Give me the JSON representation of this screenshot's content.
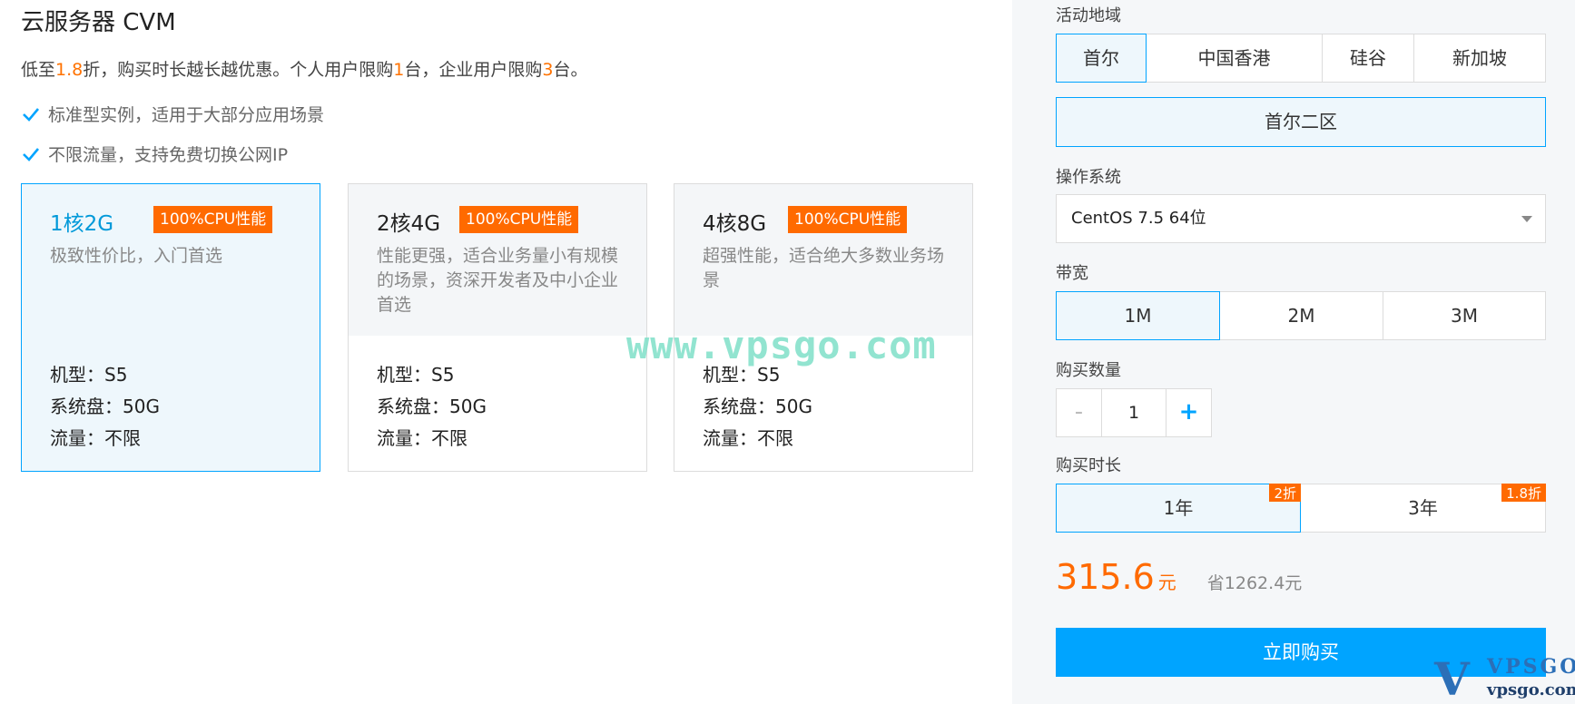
{
  "header": {
    "title": "云服务器 CVM",
    "subtitle_parts": [
      "低至",
      "1.8",
      "折，购买时长越长越优惠。个人用户限购",
      "1",
      "台，企业用户限购",
      "3",
      "台。"
    ]
  },
  "features": [
    "标准型实例，适用于大部分应用场景",
    "不限流量，支持免费切换公网IP"
  ],
  "cards": [
    {
      "spec": "1核2G",
      "tag": "100%CPU性能",
      "desc": "极致性价比，入门首选",
      "model": "机型：S5",
      "disk": "系统盘：50G",
      "traffic": "流量：不限",
      "selected": true
    },
    {
      "spec": "2核4G",
      "tag": "100%CPU性能",
      "desc": "性能更强，适合业务量小有规模的场景，资深开发者及中小企业首选",
      "model": "机型：S5",
      "disk": "系统盘：50G",
      "traffic": "流量：不限",
      "selected": false
    },
    {
      "spec": "4核8G",
      "tag": "100%CPU性能",
      "desc": "超强性能，适合绝大多数业务场景",
      "model": "机型：S5",
      "disk": "系统盘：50G",
      "traffic": "流量：不限",
      "selected": false
    }
  ],
  "watermark": "www.vpsgo.com",
  "panel": {
    "region_label": "活动地域",
    "regions": [
      "首尔",
      "中国香港",
      "硅谷",
      "新加坡"
    ],
    "zone": "首尔二区",
    "os_label": "操作系统",
    "os_value": "CentOS 7.5 64位",
    "bandwidth_label": "带宽",
    "bandwidths": [
      "1M",
      "2M",
      "3M"
    ],
    "qty_label": "购买数量",
    "qty_minus": "-",
    "qty_value": "1",
    "qty_plus": "+",
    "duration_label": "购买时长",
    "durations": [
      {
        "label": "1年",
        "badge": "2折"
      },
      {
        "label": "3年",
        "badge": "1.8折"
      }
    ],
    "price": "315.6",
    "price_unit": "元",
    "save": "省1262.4元",
    "buy": "立即购买"
  },
  "logo": {
    "mark": "V",
    "top": "VPSGO",
    "bottom": "vpsgo.com"
  },
  "colors": {
    "accent": "#00a4ff",
    "orange": "#ff6a00",
    "selected_bg": "#eef7fc"
  }
}
